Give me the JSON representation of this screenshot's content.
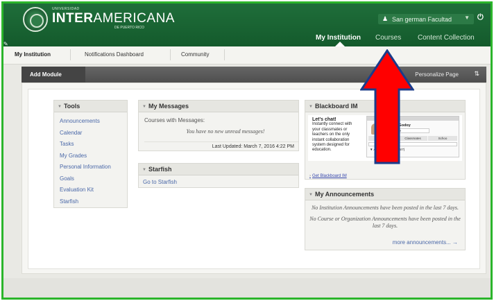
{
  "brand": {
    "small": "UNIVERSIDAD",
    "bold": "INTER",
    "light": "AMERICANA",
    "sub": "DE PUERTO RICO"
  },
  "user": {
    "name": "San german Facultad"
  },
  "top_nav": [
    "My Institution",
    "Courses",
    "Content Collection"
  ],
  "tabs": [
    "My Institution",
    "Notifications Dashboard",
    "Community"
  ],
  "module_bar": {
    "add_module": "Add Module",
    "personalize": "Personalize Page"
  },
  "tools": {
    "title": "Tools",
    "items": [
      "Announcements",
      "Calendar",
      "Tasks",
      "My Grades",
      "Personal Information",
      "Goals",
      "Evaluation Kit",
      "Starfish"
    ]
  },
  "messages": {
    "title": "My Messages",
    "courses_label": "Courses with Messages:",
    "empty": "You have no new unread messages!",
    "updated": "Last Updated: March 7, 2016 4:22 PM"
  },
  "starfish": {
    "title": "Starfish",
    "link": "Go to Starfish"
  },
  "blackboard_im": {
    "title": "Blackboard IM",
    "heading": "Let's chat!",
    "body": "Instantly connect with your classmates or teachers on the only instant collaboration system designed for education.",
    "link": "Get Blackboard IM",
    "preview": {
      "name": "Karrie Godoy",
      "status": "Available",
      "tabs": [
        "Contacts",
        "Classmates",
        "Schoo"
      ],
      "group": "American History (6/7)",
      "contacts": [
        "Cody Millwood",
        "Darcy Behn",
        "Erik Styron"
      ]
    }
  },
  "announcements": {
    "title": "My Announcements",
    "institution_empty": "No Institution Announcements have been posted in the last 7 days.",
    "course_empty": "No Course or Organization Announcements have been posted in the last 7 days.",
    "more": "more announcements... →"
  },
  "colors": {
    "header_green": "#1f6e3a",
    "frame_green": "#2bb52b",
    "link_blue": "#4a68a8",
    "annotation_red": "#ff0000"
  }
}
